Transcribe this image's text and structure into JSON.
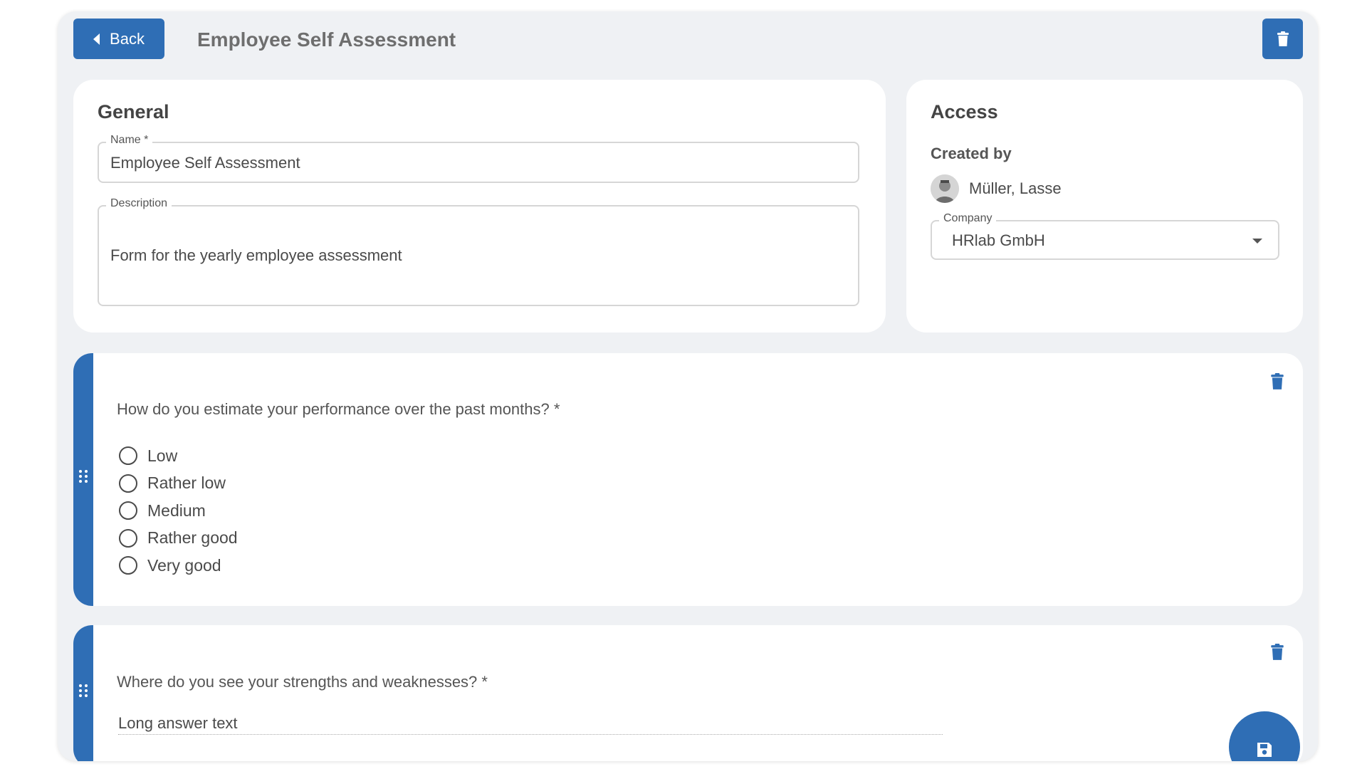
{
  "header": {
    "back_label": "Back",
    "title": "Employee Self Assessment",
    "delete_icon": "trash-icon"
  },
  "general": {
    "title": "General",
    "name_label": "Name *",
    "name_value": "Employee Self Assessment",
    "description_label": "Description",
    "description_value": "Form for the yearly employee assessment"
  },
  "access": {
    "title": "Access",
    "created_by_label": "Created by",
    "creator_name": "Müller, Lasse",
    "company_label": "Company",
    "company_value": "HRlab GmbH"
  },
  "questions": [
    {
      "text": "How do you estimate your performance over the past months? *",
      "type": "single-choice",
      "options": [
        "Low",
        "Rather low",
        "Medium",
        "Rather good",
        "Very good"
      ]
    },
    {
      "text": "Where do you see your strengths and weaknesses? *",
      "type": "long-answer",
      "placeholder": "Long answer text"
    }
  ],
  "colors": {
    "accent": "#2f6eb5",
    "background": "#eff1f4",
    "card": "#ffffff"
  },
  "icons": {
    "save": "save-icon",
    "drag": "drag-handle-icon"
  }
}
